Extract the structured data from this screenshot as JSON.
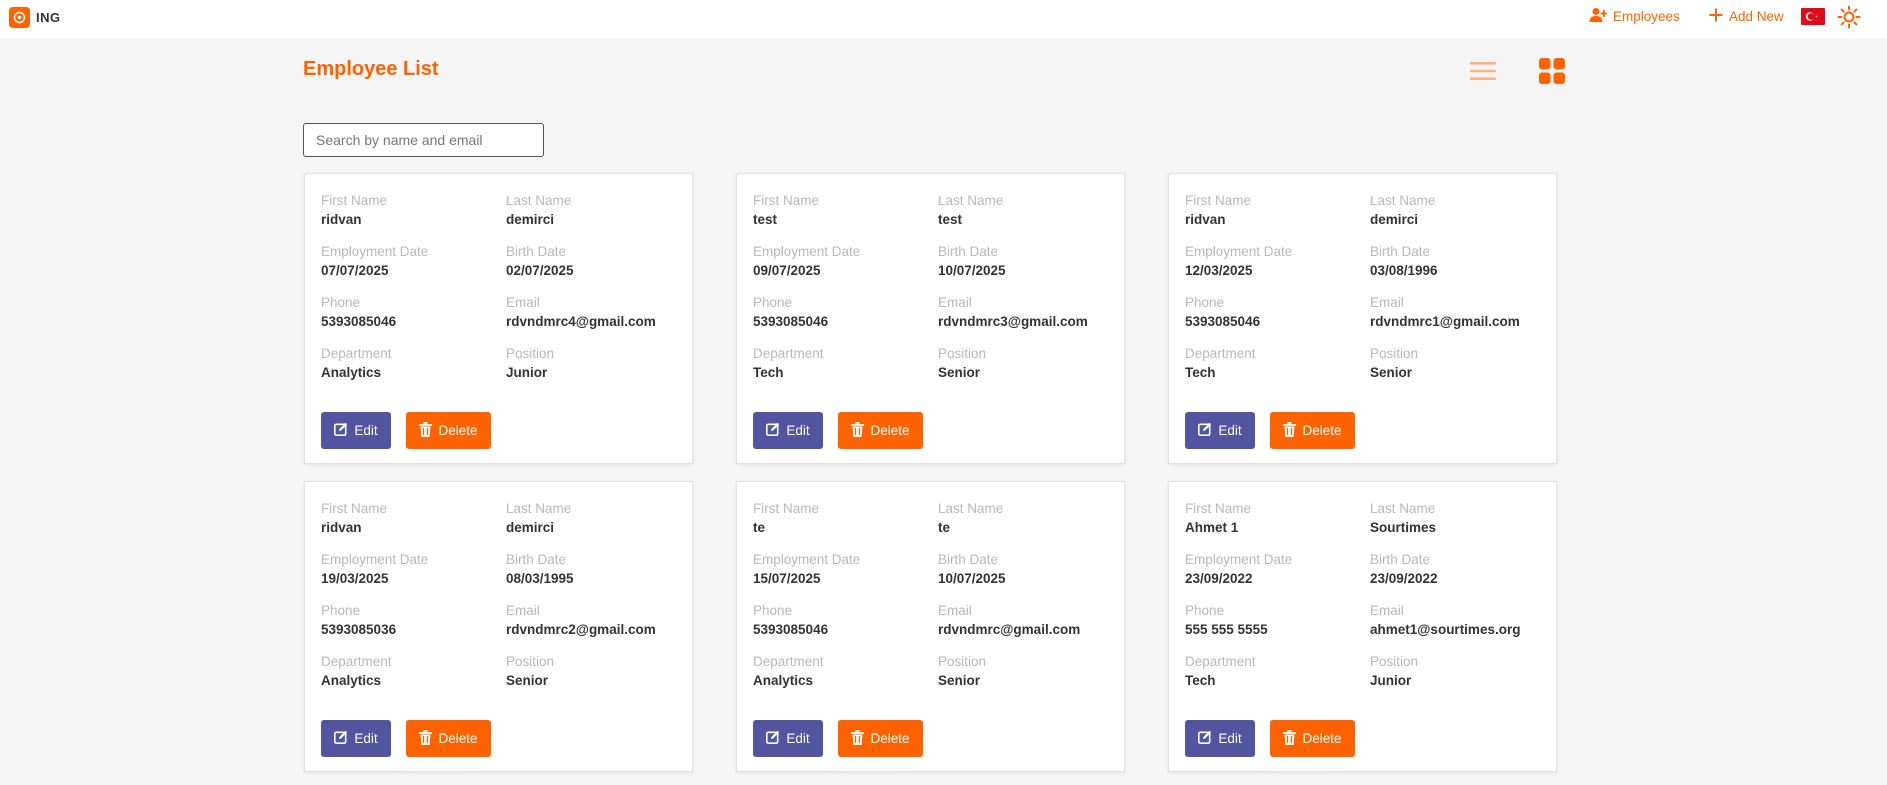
{
  "header": {
    "brand": "ING",
    "nav_employees": "Employees",
    "nav_add_new": "Add New",
    "accent_color": "#ff6200",
    "edit_color": "#5255a0"
  },
  "main": {
    "title": "Employee List",
    "search_placeholder": "Search by name and email"
  },
  "labels": {
    "first_name": "First Name",
    "last_name": "Last Name",
    "employment_date": "Employment Date",
    "birth_date": "Birth Date",
    "phone": "Phone",
    "email": "Email",
    "department": "Department",
    "position": "Position",
    "edit": "Edit",
    "delete": "Delete"
  },
  "employees": [
    {
      "first_name": "ridvan",
      "last_name": "demirci",
      "employment_date": "07/07/2025",
      "birth_date": "02/07/2025",
      "phone": "5393085046",
      "email": "rdvndmrc4@gmail.com",
      "department": "Analytics",
      "position": "Junior"
    },
    {
      "first_name": "test",
      "last_name": "test",
      "employment_date": "09/07/2025",
      "birth_date": "10/07/2025",
      "phone": "5393085046",
      "email": "rdvndmrc3@gmail.com",
      "department": "Tech",
      "position": "Senior"
    },
    {
      "first_name": "ridvan",
      "last_name": "demirci",
      "employment_date": "12/03/2025",
      "birth_date": "03/08/1996",
      "phone": "5393085046",
      "email": "rdvndmrc1@gmail.com",
      "department": "Tech",
      "position": "Senior"
    },
    {
      "first_name": "ridvan",
      "last_name": "demirci",
      "employment_date": "19/03/2025",
      "birth_date": "08/03/1995",
      "phone": "5393085036",
      "email": "rdvndmrc2@gmail.com",
      "department": "Analytics",
      "position": "Senior"
    },
    {
      "first_name": "te",
      "last_name": "te",
      "employment_date": "15/07/2025",
      "birth_date": "10/07/2025",
      "phone": "5393085046",
      "email": "rdvndmrc@gmail.com",
      "department": "Analytics",
      "position": "Senior"
    },
    {
      "first_name": "Ahmet 1",
      "last_name": "Sourtimes",
      "employment_date": "23/09/2022",
      "birth_date": "23/09/2022",
      "phone": "555 555 5555",
      "email": "ahmet1@sourtimes.org",
      "department": "Tech",
      "position": "Junior"
    }
  ]
}
